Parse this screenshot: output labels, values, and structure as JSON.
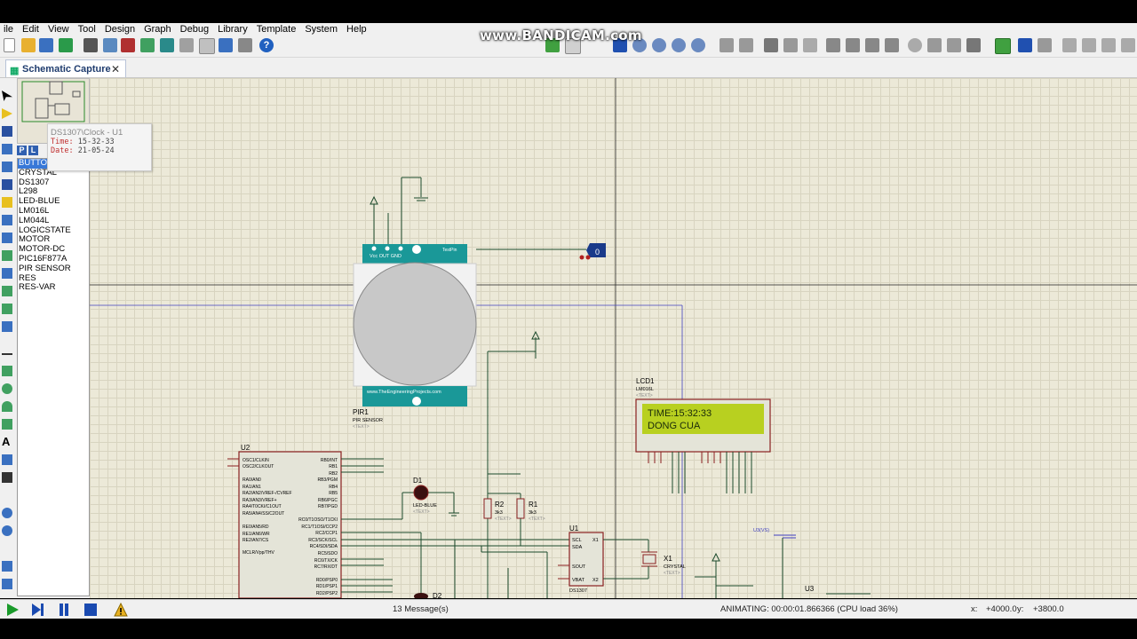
{
  "watermark": "www.BANDICAM.com",
  "menu": [
    "ile",
    "Edit",
    "View",
    "Tool",
    "Design",
    "Graph",
    "Debug",
    "Library",
    "Template",
    "System",
    "Help"
  ],
  "tab": {
    "label": "Schematic Capture",
    "close": "✕"
  },
  "picker": {
    "p": "P",
    "l": "L"
  },
  "devices": [
    "BUTTON",
    "CRYSTAL",
    "DS1307",
    "L298",
    "LED-BLUE",
    "LM016L",
    "LM044L",
    "LOGICSTATE",
    "MOTOR",
    "MOTOR-DC",
    "PIC16F877A",
    "PIR SENSOR",
    "RES",
    "RES-VAR"
  ],
  "tooltip": {
    "title": "DS1307\\Clock - U1",
    "time_label": "Time:",
    "time": "15-32-33",
    "date_label": "Date:",
    "date": "21-05-24"
  },
  "schematic": {
    "pir": {
      "ref": "PIR1",
      "name": "PIR SENSOR",
      "text": "<TEXT>",
      "pins": "Vcc  OUT  GND",
      "testpin": "TestPin",
      "site": "www.TheEngineeringProjects.com"
    },
    "logicstate_value": "0",
    "lcd": {
      "ref": "LCD1",
      "name": "LM016L",
      "text": "<TEXT>",
      "line1": "TIME:15:32:33",
      "line2": "DONG CUA"
    },
    "u2": {
      "ref": "U2",
      "left_pins": [
        "OSC1/CLKIN",
        "OSC2/CLKOUT",
        "RA0/AN0",
        "RA1/AN1",
        "RA2/AN2/VREF-/CVREF",
        "RA3/AN3/VREF+",
        "RA4/T0CKI/C1OUT",
        "RA5/AN4/SS/C2OUT",
        "RE0/AN5/RD",
        "RE1/AN6/WR",
        "RE2/AN7/CS",
        "MCLR/Vpp/THV"
      ],
      "right_pins": [
        "RB0/INT",
        "RB1",
        "RB2",
        "RB3/PGM",
        "RB4",
        "RB5",
        "RB6/PGC",
        "RB7/PGD",
        "RC0/T1OSO/T1CKI",
        "RC1/T1OSI/CCP2",
        "RC2/CCP1",
        "RC3/SCK/SCL",
        "RC4/SDI/SDA",
        "RC5/SDO",
        "RC6/TX/CK",
        "RC7/RX/DT",
        "RD0/PSP0",
        "RD1/PSP1",
        "RD2/PSP2"
      ]
    },
    "d1": {
      "ref": "D1",
      "name": "LED-BLUE",
      "text": "<TEXT>"
    },
    "d2": {
      "ref": "D2"
    },
    "r2": {
      "ref": "R2",
      "value": "3k3",
      "text": "<TEXT>"
    },
    "r1": {
      "ref": "R1",
      "value": "3k3",
      "text": "<TEXT>"
    },
    "u1": {
      "ref": "U1",
      "name": "DS1307",
      "text": "<TEXT>"
    },
    "x1": {
      "ref": "X1",
      "name": "CRYSTAL",
      "text": "<TEXT>"
    },
    "u3": {
      "ref": "U3",
      "probe": "U3(VS)"
    }
  },
  "status": {
    "messages": "13 Message(s)",
    "animating": "ANIMATING: 00:00:01.866366 (CPU load 36%)",
    "x_label": "x:",
    "x": "+4000.0",
    "y_label": "y:",
    "y": "+3800.0"
  },
  "colors": {
    "canvas": "#ece9d8",
    "wire": "#1c4a2c",
    "component": "#8a2020",
    "lcd_screen": "#b8d020",
    "pir_teal": "#1a9898",
    "selection": "#3878d8"
  }
}
